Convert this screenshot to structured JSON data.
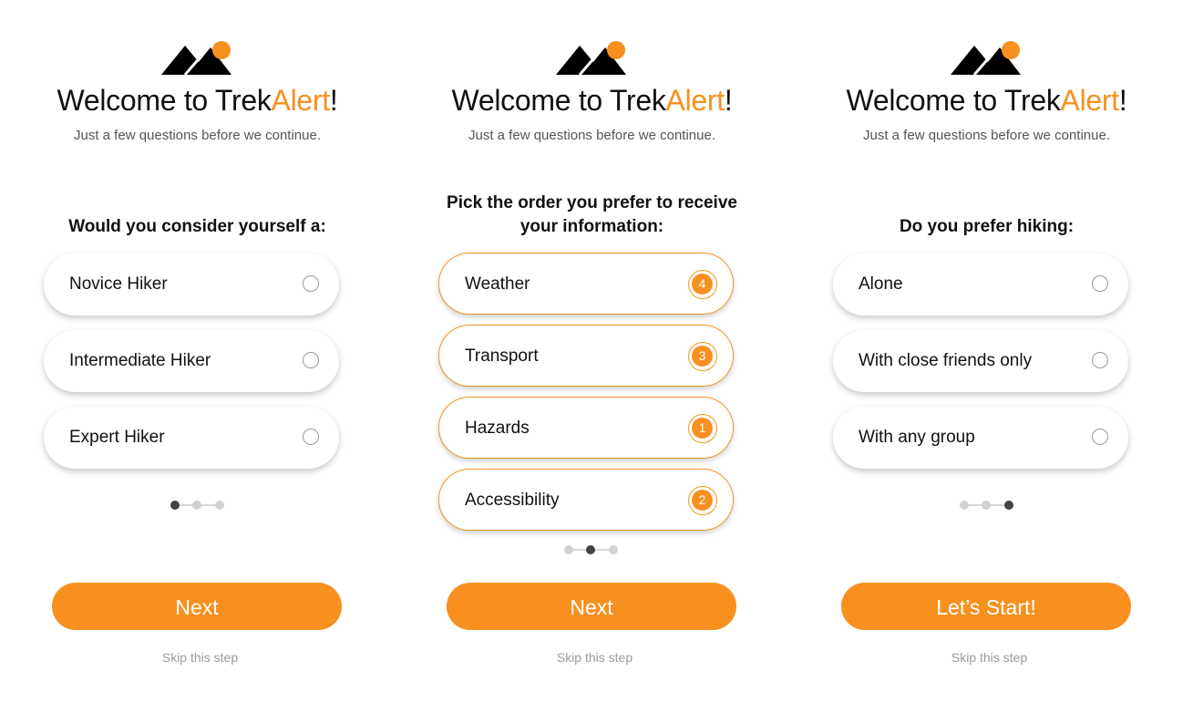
{
  "brand": {
    "accent_color": "#f7901e",
    "logo_icon": "mountain-sun-icon"
  },
  "screens": [
    {
      "title_prefix": "Welcome to Trek",
      "title_accent": "Alert",
      "title_suffix": "!",
      "subtitle": "Just a few questions before we continue.",
      "question": "Would you consider yourself a:",
      "options": [
        {
          "label": "Novice Hiker"
        },
        {
          "label": "Intermediate Hiker"
        },
        {
          "label": "Expert Hiker"
        }
      ],
      "step": {
        "current": 1,
        "total": 3
      },
      "cta": "Next",
      "skip": "Skip this step"
    },
    {
      "title_prefix": "Welcome to Trek",
      "title_accent": "Alert",
      "title_suffix": "!",
      "subtitle": "Just a few questions before we continue.",
      "question": "Pick the order you prefer to receive your information:",
      "options": [
        {
          "label": "Weather",
          "rank": "4"
        },
        {
          "label": "Transport",
          "rank": "3"
        },
        {
          "label": "Hazards",
          "rank": "1"
        },
        {
          "label": "Accessibility",
          "rank": "2"
        }
      ],
      "step": {
        "current": 2,
        "total": 3
      },
      "cta": "Next",
      "skip": "Skip this step"
    },
    {
      "title_prefix": "Welcome to Trek",
      "title_accent": "Alert",
      "title_suffix": "!",
      "subtitle": "Just a few questions before we continue.",
      "question": "Do you prefer hiking:",
      "options": [
        {
          "label": "Alone"
        },
        {
          "label": "With close friends only"
        },
        {
          "label": "With any group"
        }
      ],
      "step": {
        "current": 3,
        "total": 3
      },
      "cta": "Let’s Start!",
      "skip": "Skip this step"
    }
  ]
}
